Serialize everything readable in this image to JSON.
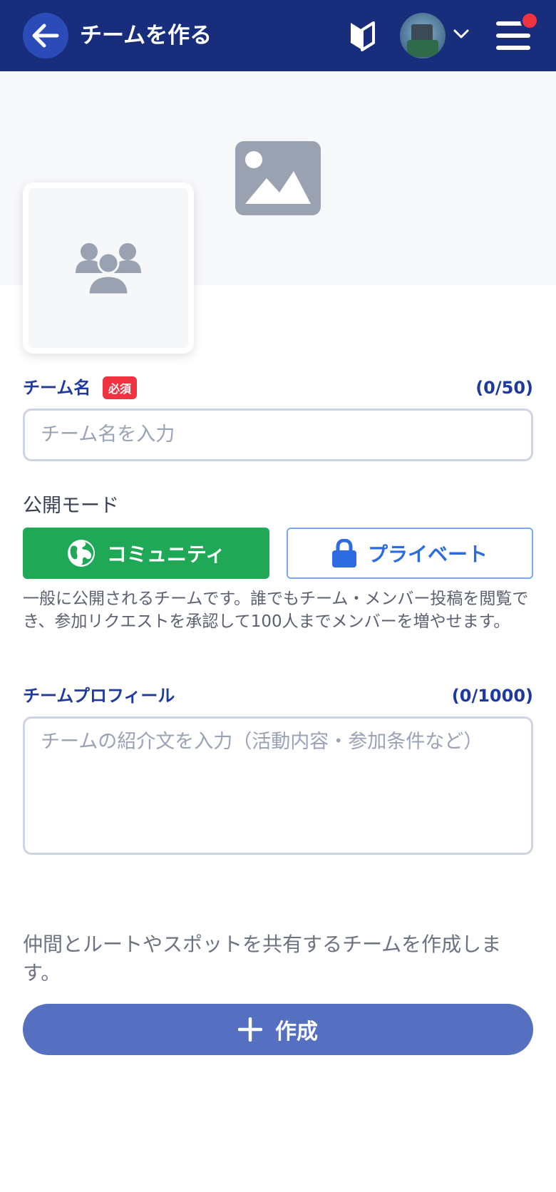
{
  "header": {
    "title": "チームを作る",
    "back_icon": "arrow-left-icon",
    "beginner_icon": "beginner-mark-icon",
    "menu_icon": "hamburger-menu-icon",
    "colors": {
      "background": "#182d7c",
      "notification": "#ef3340"
    }
  },
  "cover": {
    "placeholder_icon": "image-icon"
  },
  "team_icon": {
    "placeholder_icon": "users-icon"
  },
  "team_name": {
    "label": "チーム名",
    "required_badge": "必須",
    "counter": "(0/50)",
    "placeholder": "チーム名を入力"
  },
  "visibility": {
    "label": "公開モード",
    "community_label": "コミュニティ",
    "private_label": "プライベート",
    "selected": "community",
    "description": "一般に公開されるチームです。誰でもチーム・メンバー投稿を閲覧でき、参加リクエストを承認して100人までメンバーを増やせます。",
    "colors": {
      "community": "#1fa957",
      "private": "#2c6be0"
    }
  },
  "profile": {
    "label": "チームプロフィール",
    "counter": "(0/1000)",
    "placeholder": "チームの紹介文を入力（活動内容・参加条件など）"
  },
  "footer": {
    "note": "仲間とルートやスポットを共有するチームを作成します。",
    "create_label": "作成",
    "create_color": "#5570c0"
  }
}
